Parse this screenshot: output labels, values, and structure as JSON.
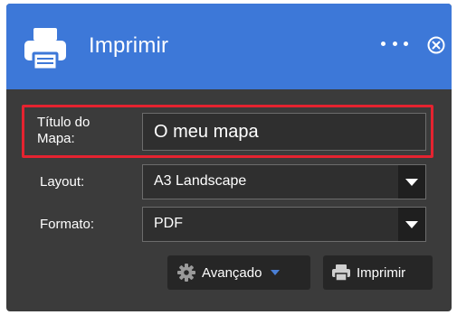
{
  "header": {
    "title": "Imprimir",
    "icon": "printer-icon",
    "more_icon": "more-horizontal-icon",
    "close_icon": "close-circle-icon",
    "background": "#3d78d8"
  },
  "form": {
    "map_title": {
      "label_line1": "Título do",
      "label_line2": "Mapa:",
      "value": "O meu mapa",
      "highlight_color": "#e52330"
    },
    "layout": {
      "label": "Layout:",
      "selected": "A3 Landscape"
    },
    "format": {
      "label": "Formato:",
      "selected": "PDF"
    }
  },
  "actions": {
    "advanced_label": "Avançado",
    "advanced_icon": "gear-icon",
    "print_label": "Imprimir",
    "print_icon": "printer-icon"
  }
}
